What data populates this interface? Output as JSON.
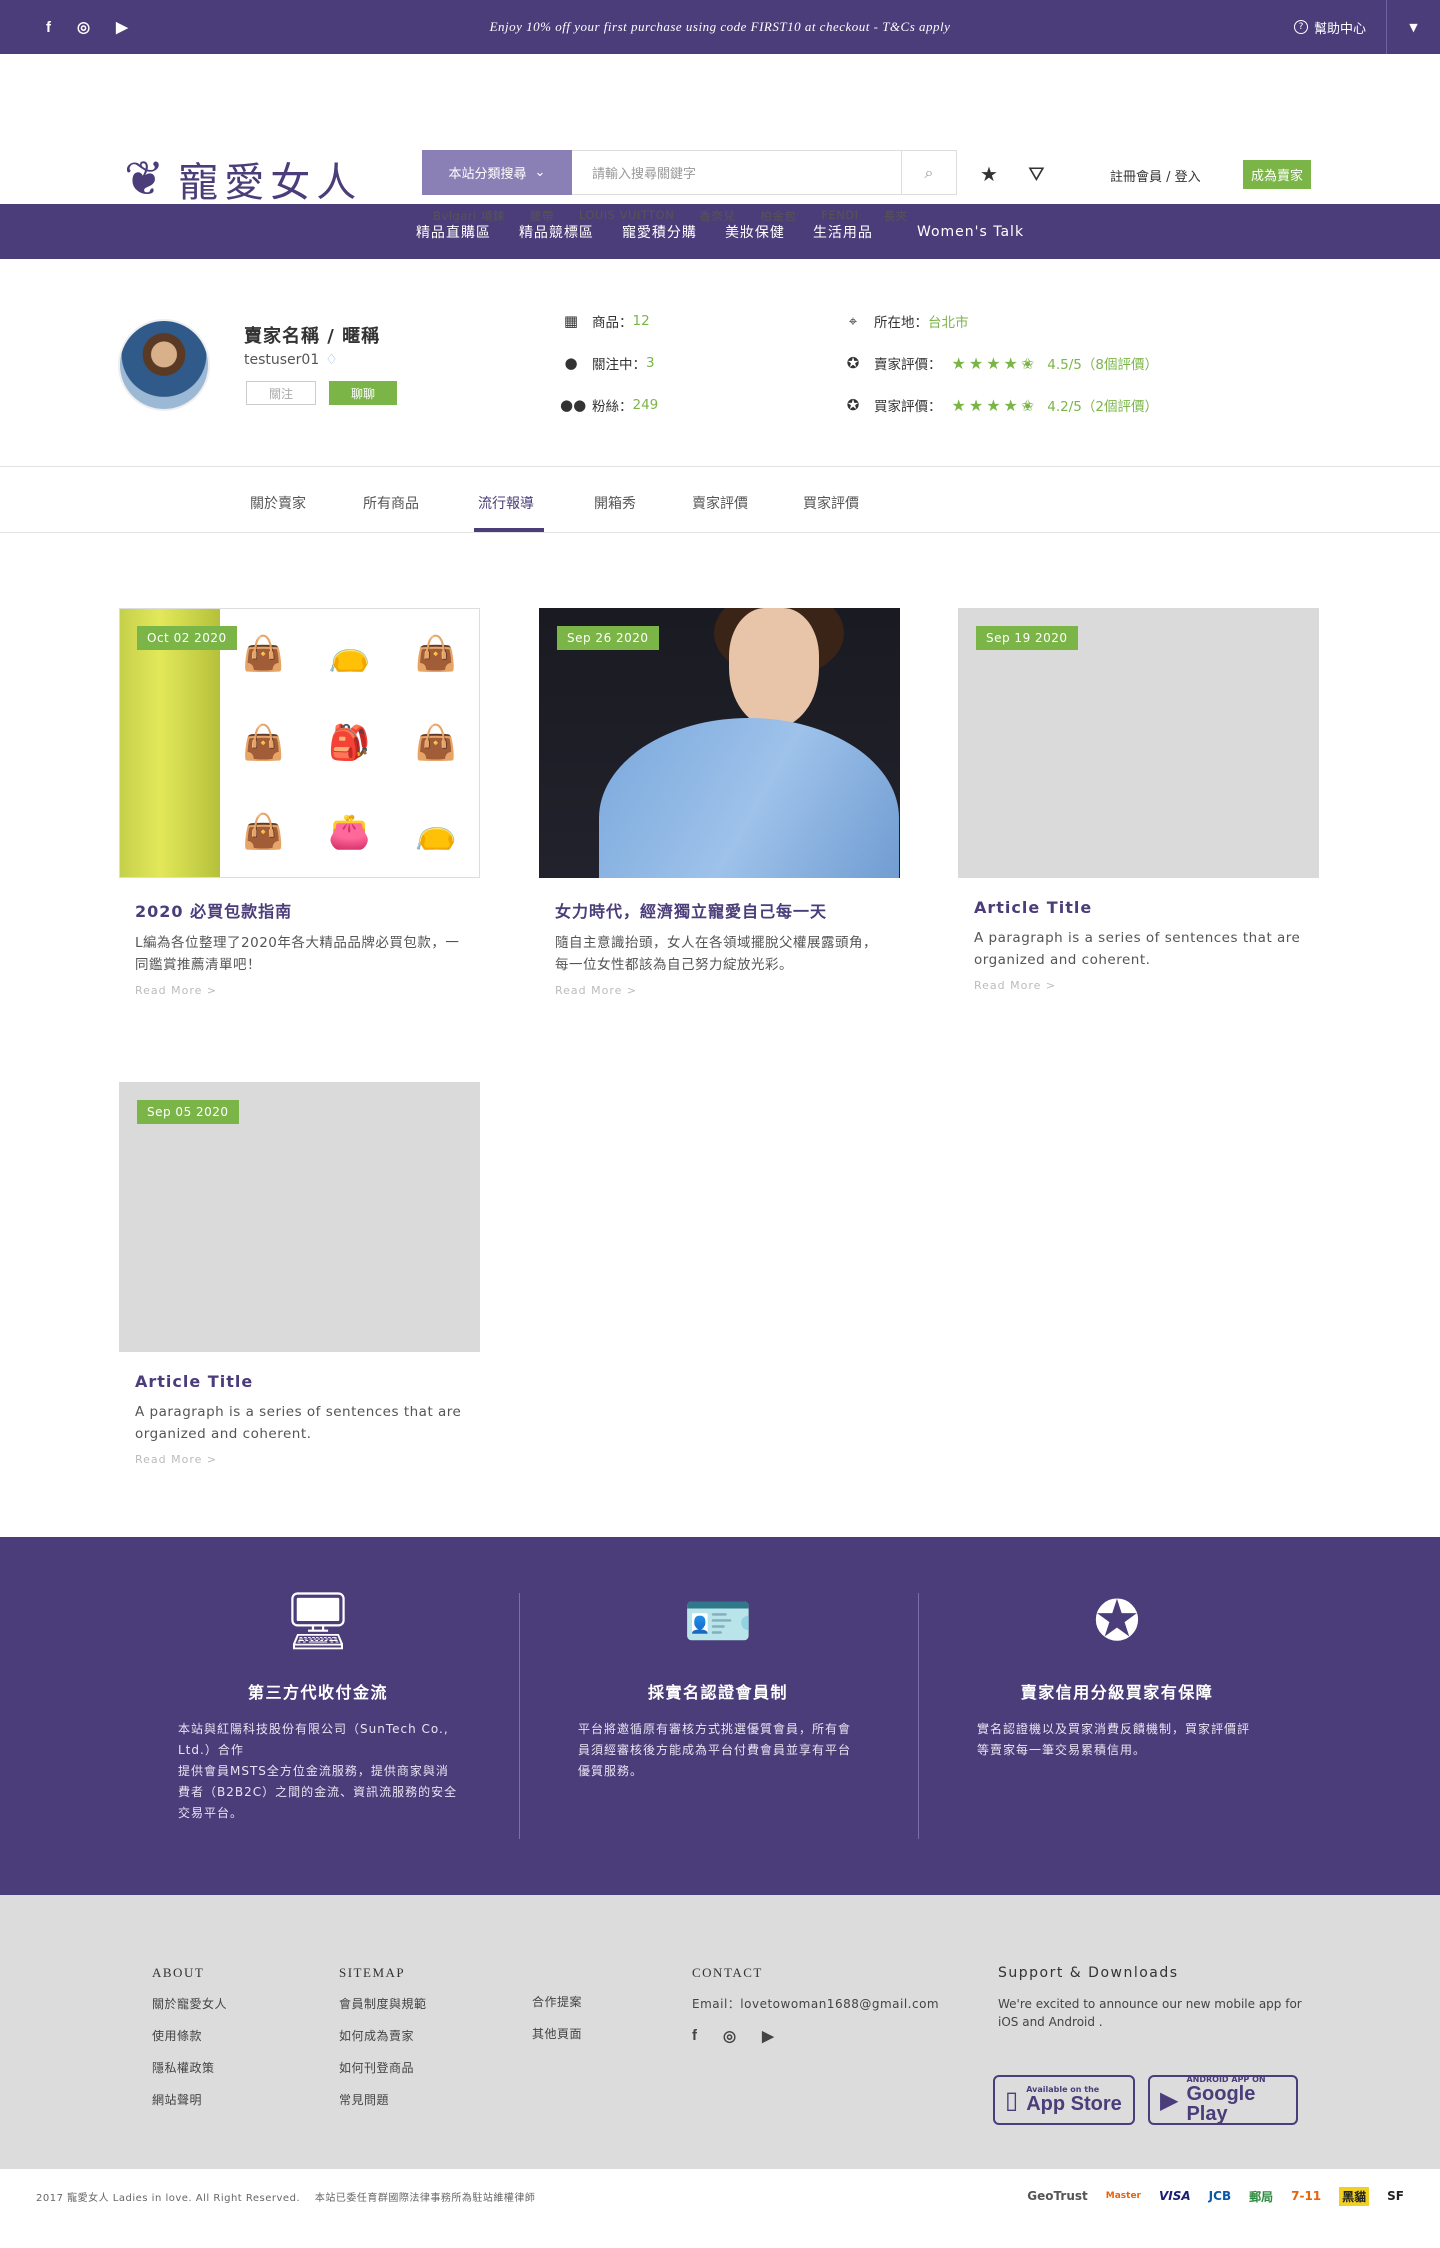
{
  "topbar": {
    "promo": "Enjoy 10% off your first purchase using code FIRST10 at checkout - T&Cs apply",
    "help": "幫助中心",
    "social": [
      "f",
      "◎",
      "▶"
    ]
  },
  "header": {
    "logo_text": "寵愛女人",
    "search_category": "本站分類搜尋",
    "search_placeholder": "請輸入搜尋關鍵字",
    "hot_keywords": [
      "Bvlgari 項鍊",
      "腰帶",
      "LOUIS VUITTON",
      "香奈兒",
      "柏金包",
      "FENDI",
      "長夾"
    ],
    "login": "註冊會員 / 登入",
    "become_seller": "成為賣家"
  },
  "nav": [
    "精品直購區",
    "精品競標區",
    "寵愛積分購",
    "美妝保健",
    "生活用品",
    "Women's Talk"
  ],
  "profile": {
    "name": "賣家名稱 / 暱稱",
    "username": "testuser01",
    "follow": "關注",
    "chat": "聊聊",
    "products_label": "商品：",
    "products_value": "12",
    "following_label": "關注中：",
    "following_value": "3",
    "fans_label": "粉絲：",
    "fans_value": "249",
    "location_label": "所在地：",
    "location_value": "台北市",
    "seller_rating_label": "賣家評價：",
    "seller_rating_stars": "★★★★✬",
    "seller_rating_value": "4.5/5（8個評價）",
    "buyer_rating_label": "買家評價：",
    "buyer_rating_stars": "★★★★✬",
    "buyer_rating_value": "4.2/5（2個評價）"
  },
  "tabs": [
    "關於賣家",
    "所有商品",
    "流行報導",
    "開箱秀",
    "賣家評價",
    "買家評價"
  ],
  "articles": [
    {
      "date": "Oct 02 2020",
      "title": "2020 必買包款指南",
      "desc": "L編為各位整理了2020年各大精品品牌必買包款，一同鑑賞推薦清單吧！",
      "more": "Read More >"
    },
    {
      "date": "Sep 26 2020",
      "title": "女力時代，經濟獨立寵愛自己每一天",
      "desc": "隨自主意識抬頭，女人在各領域擺脫父權展露頭角，每一位女性都該為自己努力綻放光彩。",
      "more": "Read More >"
    },
    {
      "date": "Sep 19 2020",
      "title": "Article Title",
      "desc": "A paragraph is a series of sentences that are organized and coherent.",
      "more": "Read More >"
    },
    {
      "date": "Sep 05 2020",
      "title": "Article Title",
      "desc": "A paragraph is a series of sentences that are organized and coherent.",
      "more": "Read More >"
    }
  ],
  "features": [
    {
      "title": "第三方代收付金流",
      "desc": "本站與紅陽科技股份有限公司（SunTech Co., Ltd.）合作\n提供會員MSTS全方位金流服務，提供商家與消費者（B2B2C）之間的金流、資訊流服務的安全交易平台。"
    },
    {
      "title": "採實名認證會員制",
      "desc": "平台將邀循原有審核方式挑選優質會員，所有會員須經審核後方能成為平台付費會員並享有平台優質服務。"
    },
    {
      "title": "賣家信用分級買家有保障",
      "desc": "實名認證機以及買家消費反饋機制，買家評價評等賣家每一筆交易累積信用。"
    }
  ],
  "footer": {
    "about_heading": "ABOUT",
    "about_links": [
      "關於寵愛女人",
      "使用條款",
      "隱私權政策",
      "網站聲明"
    ],
    "sitemap_heading": "SITEMAP",
    "sitemap_links": [
      "會員制度與規範",
      "如何成為賣家",
      "如何刊登商品",
      "常見問題"
    ],
    "sitemap_links2": [
      "合作提案",
      "其他頁面"
    ],
    "contact_heading": "CONTACT",
    "contact_email": "Email：lovetowoman1688@gmail.com",
    "support_heading": "Support & Downloads",
    "support_text": "We're excited to announce our new mobile app for iOS and Android .",
    "appstore_small": "Available on the",
    "appstore_big": "App Store",
    "gplay_small": "ANDROID APP ON",
    "gplay_big": "Google Play",
    "copyright": "2017 寵愛女人 Ladies in love. All Right Reserved.    本站已委任育群國際法律事務所為駐站維權律師",
    "payments": [
      "GeoTrust",
      "Master",
      "VISA",
      "JCB",
      "郵局",
      "7-11",
      "黑貓",
      "SF"
    ]
  }
}
